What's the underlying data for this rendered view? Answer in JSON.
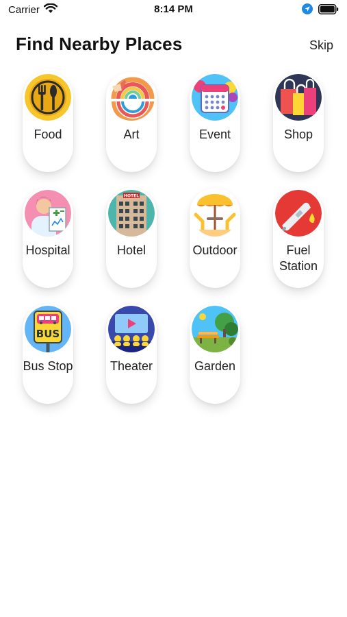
{
  "status_bar": {
    "carrier": "Carrier",
    "time": "8:14 PM"
  },
  "header": {
    "title": "Find Nearby Places",
    "skip_label": "Skip"
  },
  "places": [
    {
      "label": "Food",
      "icon": "food-icon"
    },
    {
      "label": "Art",
      "icon": "art-icon"
    },
    {
      "label": "Event",
      "icon": "event-icon"
    },
    {
      "label": "Shop",
      "icon": "shop-icon"
    },
    {
      "label": "Hospital",
      "icon": "hospital-icon"
    },
    {
      "label": "Hotel",
      "icon": "hotel-icon"
    },
    {
      "label": "Outdoor",
      "icon": "outdoor-icon"
    },
    {
      "label": "Fuel Station",
      "icon": "fuel-station-icon"
    },
    {
      "label": "Bus Stop",
      "icon": "bus-stop-icon"
    },
    {
      "label": "Theater",
      "icon": "theater-icon"
    },
    {
      "label": "Garden",
      "icon": "garden-icon"
    }
  ],
  "colors": {
    "card_background": "#ffffff",
    "text": "#222222",
    "accent_blue": "#1e88e5"
  }
}
